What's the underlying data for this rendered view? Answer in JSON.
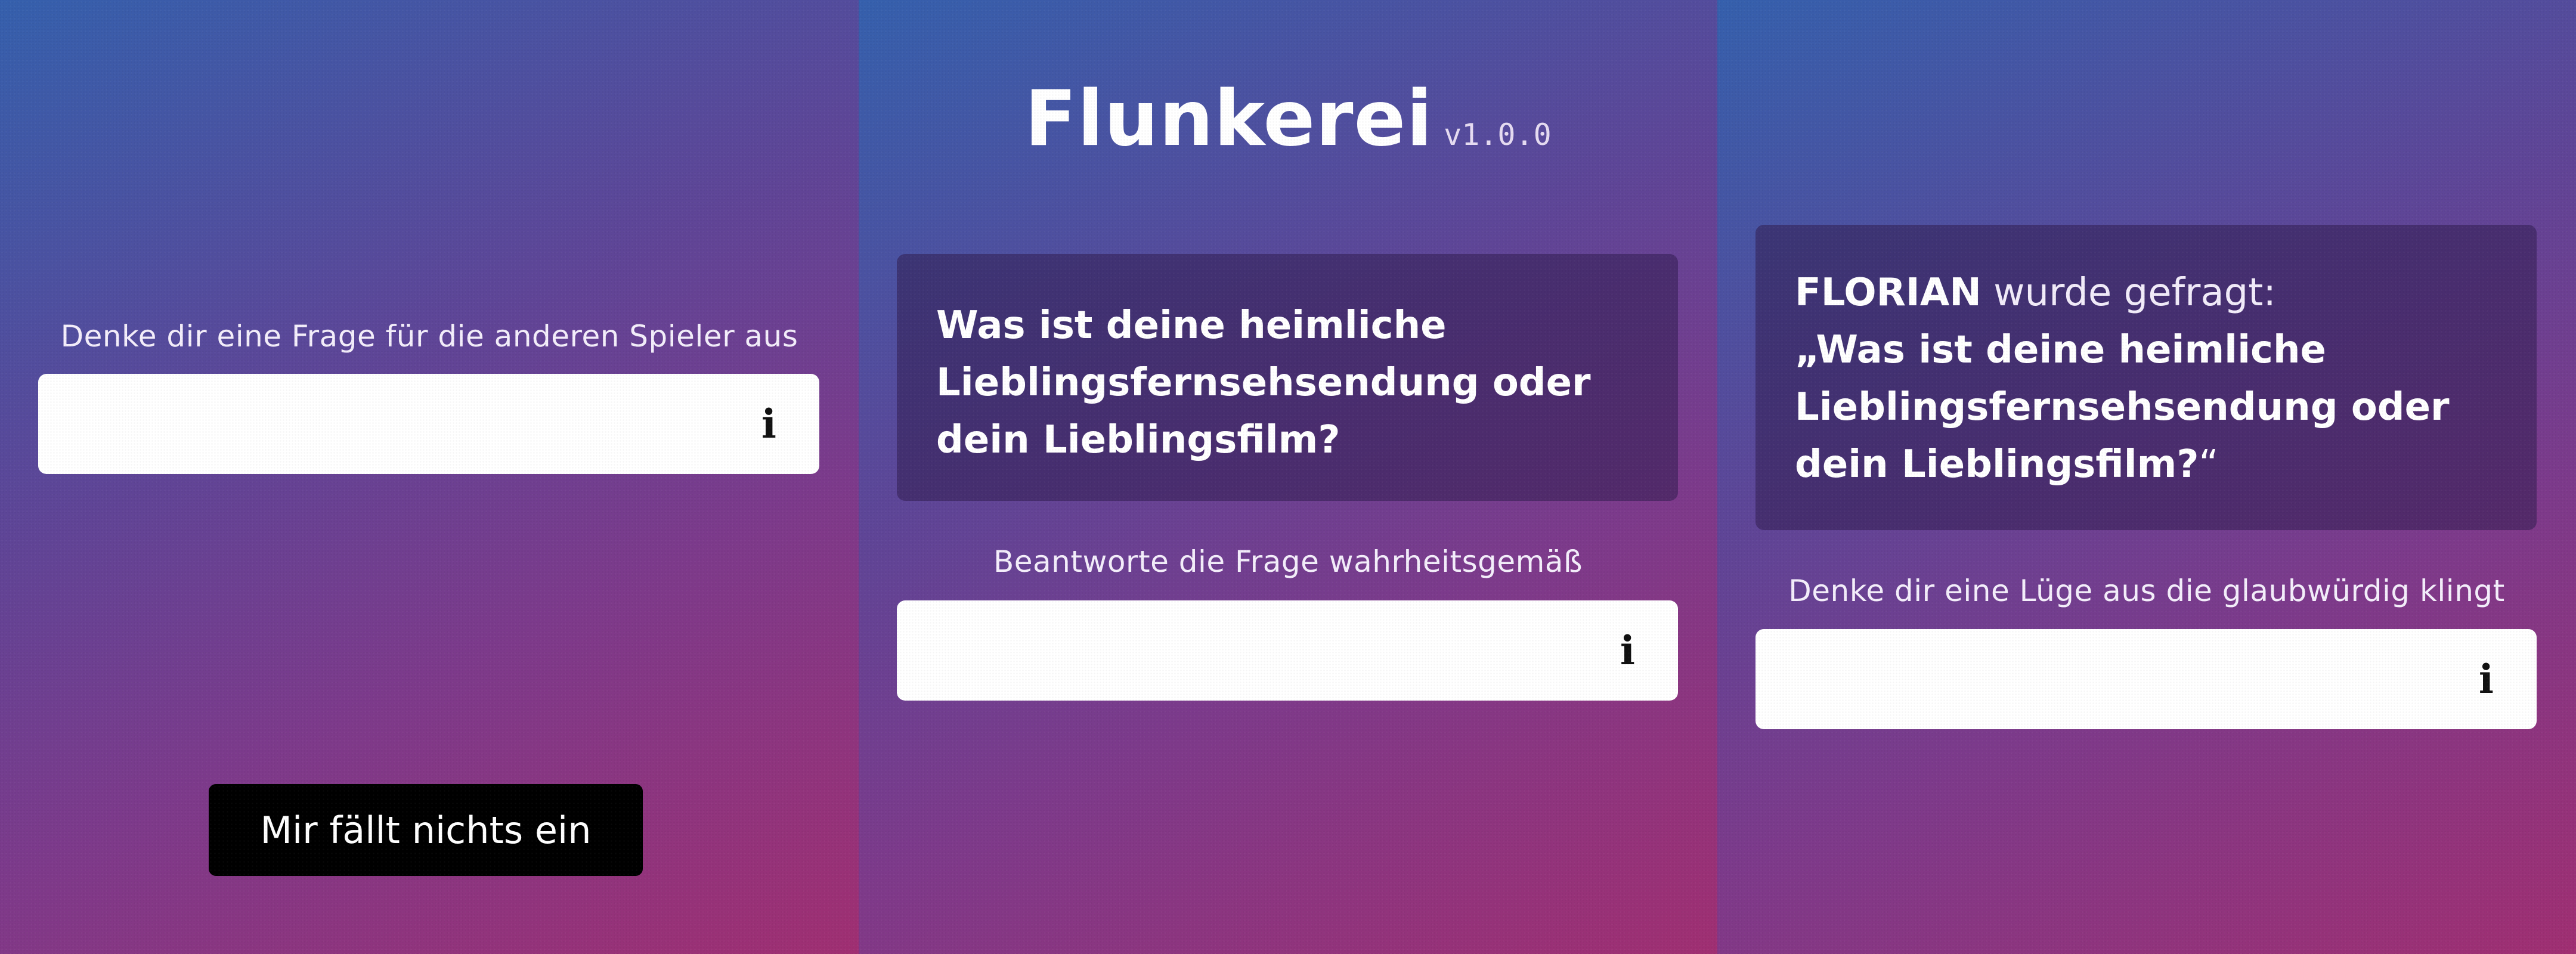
{
  "screen1": {
    "prompt": "Denke dir eine Frage für die anderen Spieler aus",
    "input": {
      "value": "",
      "placeholder": "",
      "info_icon": "i"
    },
    "button_label": "Mir fällt nichts ein"
  },
  "screen2": {
    "app_title": "Flunkerei",
    "app_version": "v1.0.0",
    "question": "Was ist deine heimliche Lieblingsfernsehsendung oder dein Lieblingsfilm?",
    "prompt": "Beantworte die Frage wahrheitsgemäß",
    "input": {
      "value": "",
      "placeholder": "",
      "info_icon": "i"
    }
  },
  "screen3": {
    "player_name": "FLORIAN",
    "asked_text": "wurde gefragt:",
    "question_quoted": "„Was ist deine heimliche Lieblingsfernsehsendung oder dein Lieblingsfilm?",
    "quote_close": "“",
    "prompt": "Denke dir eine Lüge aus die glaubwürdig klingt",
    "input": {
      "value": "",
      "placeholder": "",
      "info_icon": "i"
    }
  },
  "colors": {
    "gradient_start": "#3560ad",
    "gradient_mid": "#7d3a8b",
    "gradient_end": "#a02f72",
    "card_background": "rgba(50,30,80,0.55)",
    "button_background": "#000000",
    "field_background": "#ffffff"
  },
  "icons": {
    "info": "info-icon"
  }
}
